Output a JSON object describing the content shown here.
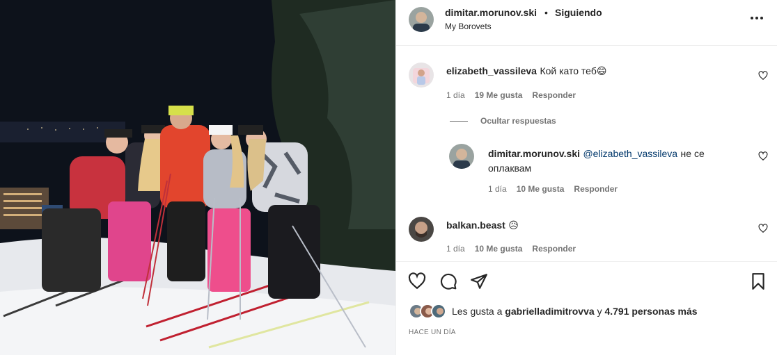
{
  "post": {
    "author": "dimitar.morunov.ski",
    "separator": "•",
    "follow_status": "Siguiendo",
    "location": "My Borovets",
    "more_icon": "more-horizontal-icon"
  },
  "comments": [
    {
      "user": "elizabeth_vassileva",
      "text": "Кой като теб😄",
      "time": "1 día",
      "likes": "19 Me gusta",
      "reply": "Responder"
    },
    {
      "user": "dimitar.morunov.ski",
      "mention": "@elizabeth_vassileva",
      "text_line1": "не се",
      "text_line2": "оплаквам",
      "time": "1 día",
      "likes": "10 Me gusta",
      "reply": "Responder"
    },
    {
      "user": "balkan.beast",
      "text": "😥",
      "time": "1 día",
      "likes": "10 Me gusta",
      "reply": "Responder"
    }
  ],
  "hide_replies": "Ocultar respuestas",
  "likes_summary": {
    "prefix": "Les gusta a",
    "user": "gabrielladimitrovva",
    "conj": "y",
    "others": "4.791 personas más"
  },
  "posted_ago": "HACE UN DÍA",
  "colors": {
    "text": "#262626",
    "secondary": "#737373",
    "mention": "#00376b",
    "border": "#efefef"
  }
}
